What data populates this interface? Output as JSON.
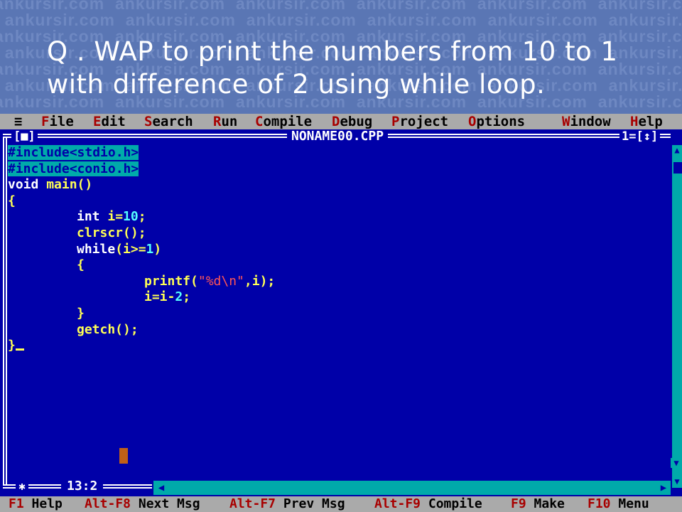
{
  "banner": {
    "watermark_text": "ankursir.com",
    "question_line1": "Q . WAP to print the numbers from 10 to 1",
    "question_line2": "with difference of 2 using while loop."
  },
  "menubar": {
    "system_icon": "≡",
    "items": [
      {
        "hotkey": "F",
        "rest": "ile"
      },
      {
        "hotkey": "E",
        "rest": "dit"
      },
      {
        "hotkey": "S",
        "rest": "earch"
      },
      {
        "hotkey": "R",
        "rest": "un"
      },
      {
        "hotkey": "C",
        "rest": "ompile"
      },
      {
        "hotkey": "D",
        "rest": "ebug"
      },
      {
        "hotkey": "P",
        "rest": "roject"
      },
      {
        "hotkey": "O",
        "rest": "ptions"
      },
      {
        "hotkey": "W",
        "rest": "indow"
      },
      {
        "hotkey": "H",
        "rest": "elp"
      }
    ]
  },
  "editor": {
    "filename": "NONAME00.CPP",
    "close_box": "[■]",
    "window_number": "1=[↕]",
    "cursor_position": "13:2",
    "code": {
      "line1": "#include<stdio.h>",
      "line2": "#include<conio.h>",
      "line3_kw": "void",
      "line3_rest": " main()",
      "line4": "{",
      "line5_kw": "int",
      "line5_id": " i=",
      "line5_num": "10",
      "line5_end": ";",
      "line6": "clrscr();",
      "line7_kw": "while",
      "line7_id": "(i>=",
      "line7_num": "1",
      "line7_end": ")",
      "line8": "{",
      "line9_fn": "printf(",
      "line9_str": "\"%d\\n\"",
      "line9_end": ",i);",
      "line10_a": "i=i-",
      "line10_num": "2",
      "line10_end": ";",
      "line11": "}",
      "line12": "getch();",
      "line13": "}"
    }
  },
  "fkeys": [
    {
      "key": "F1",
      "label": " Help"
    },
    {
      "key": "Alt-F8",
      "label": " Next Msg"
    },
    {
      "key": "Alt-F7",
      "label": " Prev Msg"
    },
    {
      "key": "Alt-F9",
      "label": " Compile"
    },
    {
      "key": "F9",
      "label": " Make"
    },
    {
      "key": "F10",
      "label": " Menu"
    }
  ],
  "colors": {
    "editor_bg": "#0000a8",
    "menubar_bg": "#aaaaaa",
    "hotkey": "#a80000",
    "banner_bg": "#5a76b4"
  }
}
